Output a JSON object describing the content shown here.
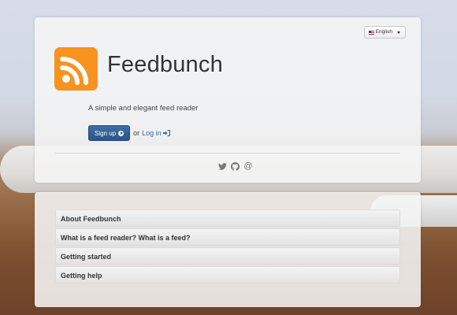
{
  "language": {
    "label": "English",
    "flag_icon": "us-flag-icon"
  },
  "brand": {
    "name": "Feedbunch",
    "logo_icon": "rss-icon",
    "logo_color": "#f7931e",
    "tagline": "A simple and elegant feed reader"
  },
  "actions": {
    "signup_label": "Sign up",
    "or_text": "or",
    "login_label": "Log in",
    "accent": "#2a5585",
    "link_color": "#2a6db5"
  },
  "social": {
    "twitter_icon": "twitter-icon",
    "github_icon": "github-icon",
    "email_icon": "at-icon",
    "email_glyph": "@"
  },
  "faq": {
    "items": [
      {
        "label": "About Feedbunch"
      },
      {
        "label": "What is a feed reader? What is a feed?"
      },
      {
        "label": "Getting started"
      },
      {
        "label": "Getting help"
      }
    ]
  }
}
